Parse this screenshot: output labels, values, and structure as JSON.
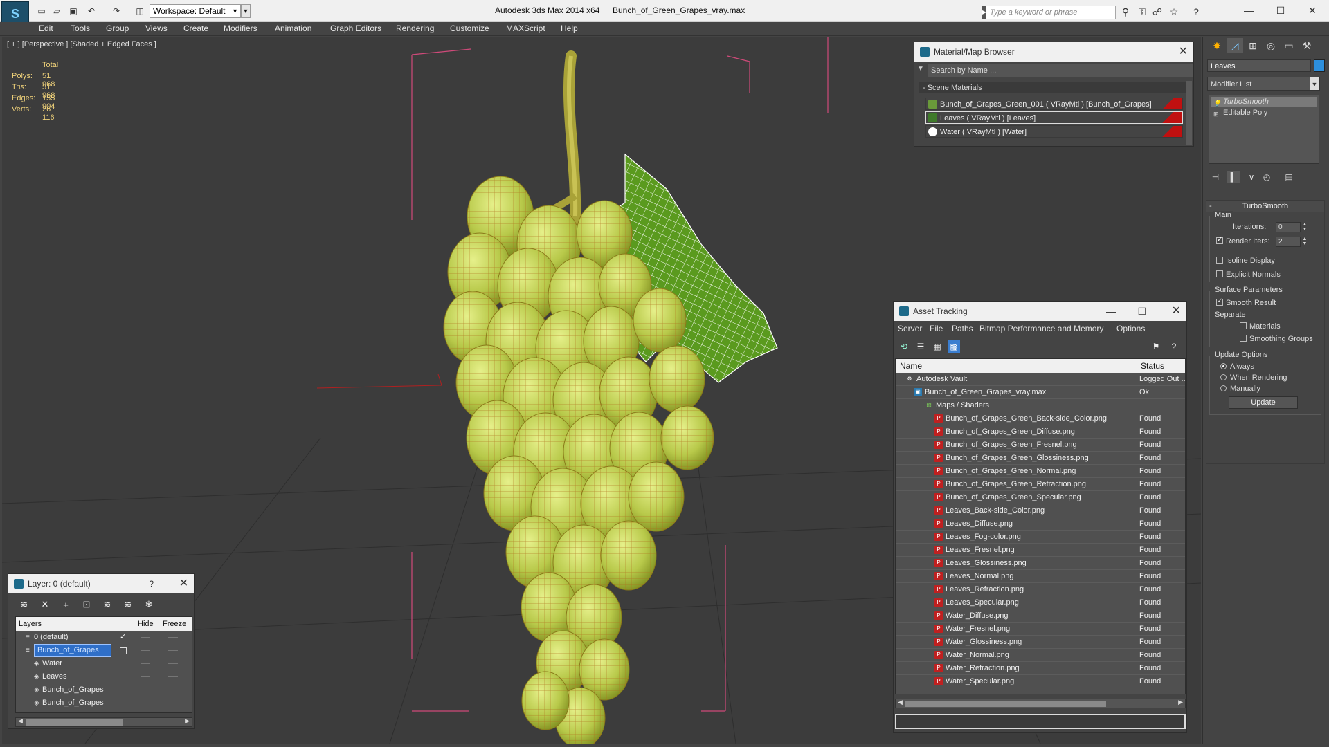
{
  "titlebar": {
    "app_title": "Autodesk 3ds Max  2014 x64",
    "document": "Bunch_of_Green_Grapes_vray.max",
    "workspace_label": "Workspace: Default",
    "search_placeholder": "Type a keyword or phrase"
  },
  "menu": [
    "Edit",
    "Tools",
    "Group",
    "Views",
    "Create",
    "Modifiers",
    "Animation",
    "Graph Editors",
    "Rendering",
    "Customize",
    "MAXScript",
    "Help"
  ],
  "viewport": {
    "label": "[ + ] [Perspective ] [Shaded + Edged Faces ]",
    "stats_header": "Total",
    "stats": [
      {
        "k": "Polys:",
        "v": "51 968"
      },
      {
        "k": "Tris:",
        "v": "51 968"
      },
      {
        "k": "Edges:",
        "v": "155 904"
      },
      {
        "k": "Verts:",
        "v": "26 116"
      }
    ]
  },
  "material_browser": {
    "title": "Material/Map Browser",
    "search_placeholder": "Search by Name ...",
    "section": "- Scene Materials",
    "materials": [
      {
        "label": "Bunch_of_Grapes_Green_001  ( VRayMtl )  [Bunch_of_Grapes]",
        "swatch": "#6a9a3a"
      },
      {
        "label": "Leaves  ( VRayMtl )  [Leaves]",
        "swatch": "#3f7a2a"
      },
      {
        "label": "Water  ( VRayMtl )  [Water]",
        "swatch": "#ffffff"
      }
    ]
  },
  "command_panel": {
    "object_name": "Leaves",
    "object_color": "#2d8fdc",
    "modifier_list": "Modifier List",
    "stack": [
      "TurboSmooth",
      "Editable Poly"
    ],
    "turbosmooth": {
      "title": "TurboSmooth",
      "main": "Main",
      "iterations_label": "Iterations:",
      "iterations": "0",
      "render_iters_label": "Render Iters:",
      "render_iters": "2",
      "isoline": "Isoline Display",
      "explicit": "Explicit Normals",
      "surface": "Surface Parameters",
      "smooth_result": "Smooth Result",
      "separate": "Separate",
      "materials": "Materials",
      "smoothing_groups": "Smoothing Groups",
      "update_options": "Update Options",
      "always": "Always",
      "when_rendering": "When Rendering",
      "manually": "Manually",
      "update_btn": "Update"
    }
  },
  "asset_tracking": {
    "title": "Asset Tracking",
    "menu": [
      "Server",
      "File",
      "Paths",
      "Bitmap Performance and Memory",
      "Options"
    ],
    "col_name": "Name",
    "col_status": "Status",
    "rows": [
      {
        "name": "Autodesk Vault",
        "status": "Logged Out ...",
        "level": 0,
        "icon": "vault"
      },
      {
        "name": "Bunch_of_Green_Grapes_vray.max",
        "status": "Ok",
        "level": 1,
        "icon": "max"
      },
      {
        "name": "Maps / Shaders",
        "status": "",
        "level": 2,
        "icon": "maps"
      },
      {
        "name": "Bunch_of_Grapes_Green_Back-side_Color.png",
        "status": "Found",
        "level": 3,
        "icon": "png"
      },
      {
        "name": "Bunch_of_Grapes_Green_Diffuse.png",
        "status": "Found",
        "level": 3,
        "icon": "png"
      },
      {
        "name": "Bunch_of_Grapes_Green_Fresnel.png",
        "status": "Found",
        "level": 3,
        "icon": "png"
      },
      {
        "name": "Bunch_of_Grapes_Green_Glossiness.png",
        "status": "Found",
        "level": 3,
        "icon": "png"
      },
      {
        "name": "Bunch_of_Grapes_Green_Normal.png",
        "status": "Found",
        "level": 3,
        "icon": "png"
      },
      {
        "name": "Bunch_of_Grapes_Green_Refraction.png",
        "status": "Found",
        "level": 3,
        "icon": "png"
      },
      {
        "name": "Bunch_of_Grapes_Green_Specular.png",
        "status": "Found",
        "level": 3,
        "icon": "png"
      },
      {
        "name": "Leaves_Back-side_Color.png",
        "status": "Found",
        "level": 3,
        "icon": "png"
      },
      {
        "name": "Leaves_Diffuse.png",
        "status": "Found",
        "level": 3,
        "icon": "png"
      },
      {
        "name": "Leaves_Fog-color.png",
        "status": "Found",
        "level": 3,
        "icon": "png"
      },
      {
        "name": "Leaves_Fresnel.png",
        "status": "Found",
        "level": 3,
        "icon": "png"
      },
      {
        "name": "Leaves_Glossiness.png",
        "status": "Found",
        "level": 3,
        "icon": "png"
      },
      {
        "name": "Leaves_Normal.png",
        "status": "Found",
        "level": 3,
        "icon": "png"
      },
      {
        "name": "Leaves_Refraction.png",
        "status": "Found",
        "level": 3,
        "icon": "png"
      },
      {
        "name": "Leaves_Specular.png",
        "status": "Found",
        "level": 3,
        "icon": "png"
      },
      {
        "name": "Water_Diffuse.png",
        "status": "Found",
        "level": 3,
        "icon": "png"
      },
      {
        "name": "Water_Fresnel.png",
        "status": "Found",
        "level": 3,
        "icon": "png"
      },
      {
        "name": "Water_Glossiness.png",
        "status": "Found",
        "level": 3,
        "icon": "png"
      },
      {
        "name": "Water_Normal.png",
        "status": "Found",
        "level": 3,
        "icon": "png"
      },
      {
        "name": "Water_Refraction.png",
        "status": "Found",
        "level": 3,
        "icon": "png"
      },
      {
        "name": "Water_Specular.png",
        "status": "Found",
        "level": 3,
        "icon": "png"
      }
    ]
  },
  "layer_manager": {
    "title": "Layer: 0 (default)",
    "help": "?",
    "col_layers": "Layers",
    "col_hide": "Hide",
    "col_freeze": "Freeze",
    "rows": [
      {
        "name": "0 (default)",
        "level": 0,
        "selected": false,
        "check": "✓"
      },
      {
        "name": "Bunch_of_Grapes",
        "level": 0,
        "selected": true,
        "check": ""
      },
      {
        "name": "Water",
        "level": 1,
        "selected": false,
        "check": ""
      },
      {
        "name": "Leaves",
        "level": 1,
        "selected": false,
        "check": ""
      },
      {
        "name": "Bunch_of_Grapes",
        "level": 1,
        "selected": false,
        "check": ""
      },
      {
        "name": "Bunch_of_Grapes",
        "level": 1,
        "selected": false,
        "check": ""
      }
    ]
  }
}
